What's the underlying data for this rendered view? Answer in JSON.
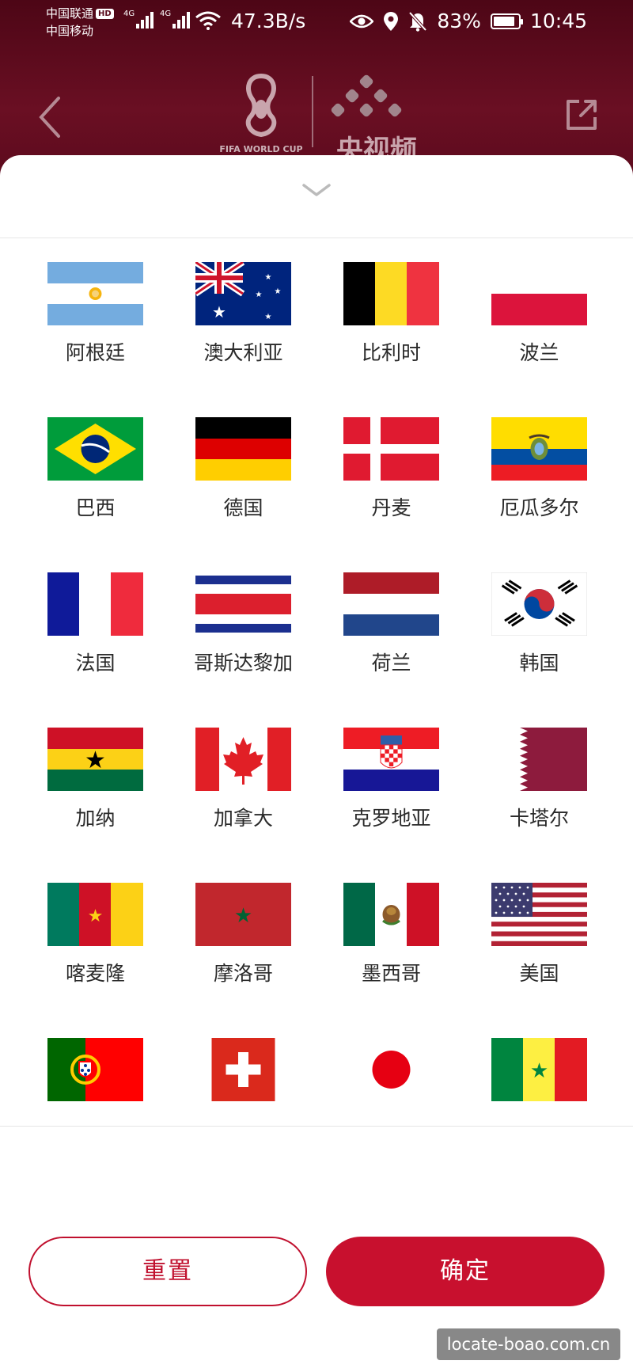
{
  "status_bar": {
    "carrier1": "中国联通",
    "hd": "HD",
    "carrier2": "中国移动",
    "net1": "4G",
    "net2": "4G",
    "net_speed": "47.3B/s",
    "battery": "83%",
    "time": "10:45"
  },
  "header": {
    "fifa_text": "FIFA WORLD CUP",
    "cctv_text": "央视频"
  },
  "countries": [
    {
      "name": "阿根廷",
      "flag": "argentina-flag-icon"
    },
    {
      "name": "澳大利亚",
      "flag": "australia-flag-icon"
    },
    {
      "name": "比利时",
      "flag": "belgium-flag-icon"
    },
    {
      "name": "波兰",
      "flag": "poland-flag-icon"
    },
    {
      "name": "巴西",
      "flag": "brazil-flag-icon"
    },
    {
      "name": "德国",
      "flag": "germany-flag-icon"
    },
    {
      "name": "丹麦",
      "flag": "denmark-flag-icon"
    },
    {
      "name": "厄瓜多尔",
      "flag": "ecuador-flag-icon"
    },
    {
      "name": "法国",
      "flag": "france-flag-icon"
    },
    {
      "name": "哥斯达黎加",
      "flag": "costa-rica-flag-icon"
    },
    {
      "name": "荷兰",
      "flag": "netherlands-flag-icon"
    },
    {
      "name": "韩国",
      "flag": "korea-flag-icon"
    },
    {
      "name": "加纳",
      "flag": "ghana-flag-icon"
    },
    {
      "name": "加拿大",
      "flag": "canada-flag-icon"
    },
    {
      "name": "克罗地亚",
      "flag": "croatia-flag-icon"
    },
    {
      "name": "卡塔尔",
      "flag": "qatar-flag-icon"
    },
    {
      "name": "喀麦隆",
      "flag": "cameroon-flag-icon"
    },
    {
      "name": "摩洛哥",
      "flag": "morocco-flag-icon"
    },
    {
      "name": "墨西哥",
      "flag": "mexico-flag-icon"
    },
    {
      "name": "美国",
      "flag": "usa-flag-icon"
    },
    {
      "name": "",
      "flag": "portugal-flag-icon"
    },
    {
      "name": "",
      "flag": "switzerland-flag-icon"
    },
    {
      "name": "",
      "flag": "japan-flag-icon"
    },
    {
      "name": "",
      "flag": "senegal-flag-icon"
    }
  ],
  "buttons": {
    "reset": "重置",
    "confirm": "确定"
  },
  "watermark": "locate-boao.com.cn",
  "colors": {
    "brand_red": "#c8102e",
    "header_bg": "#5a0b1c"
  }
}
